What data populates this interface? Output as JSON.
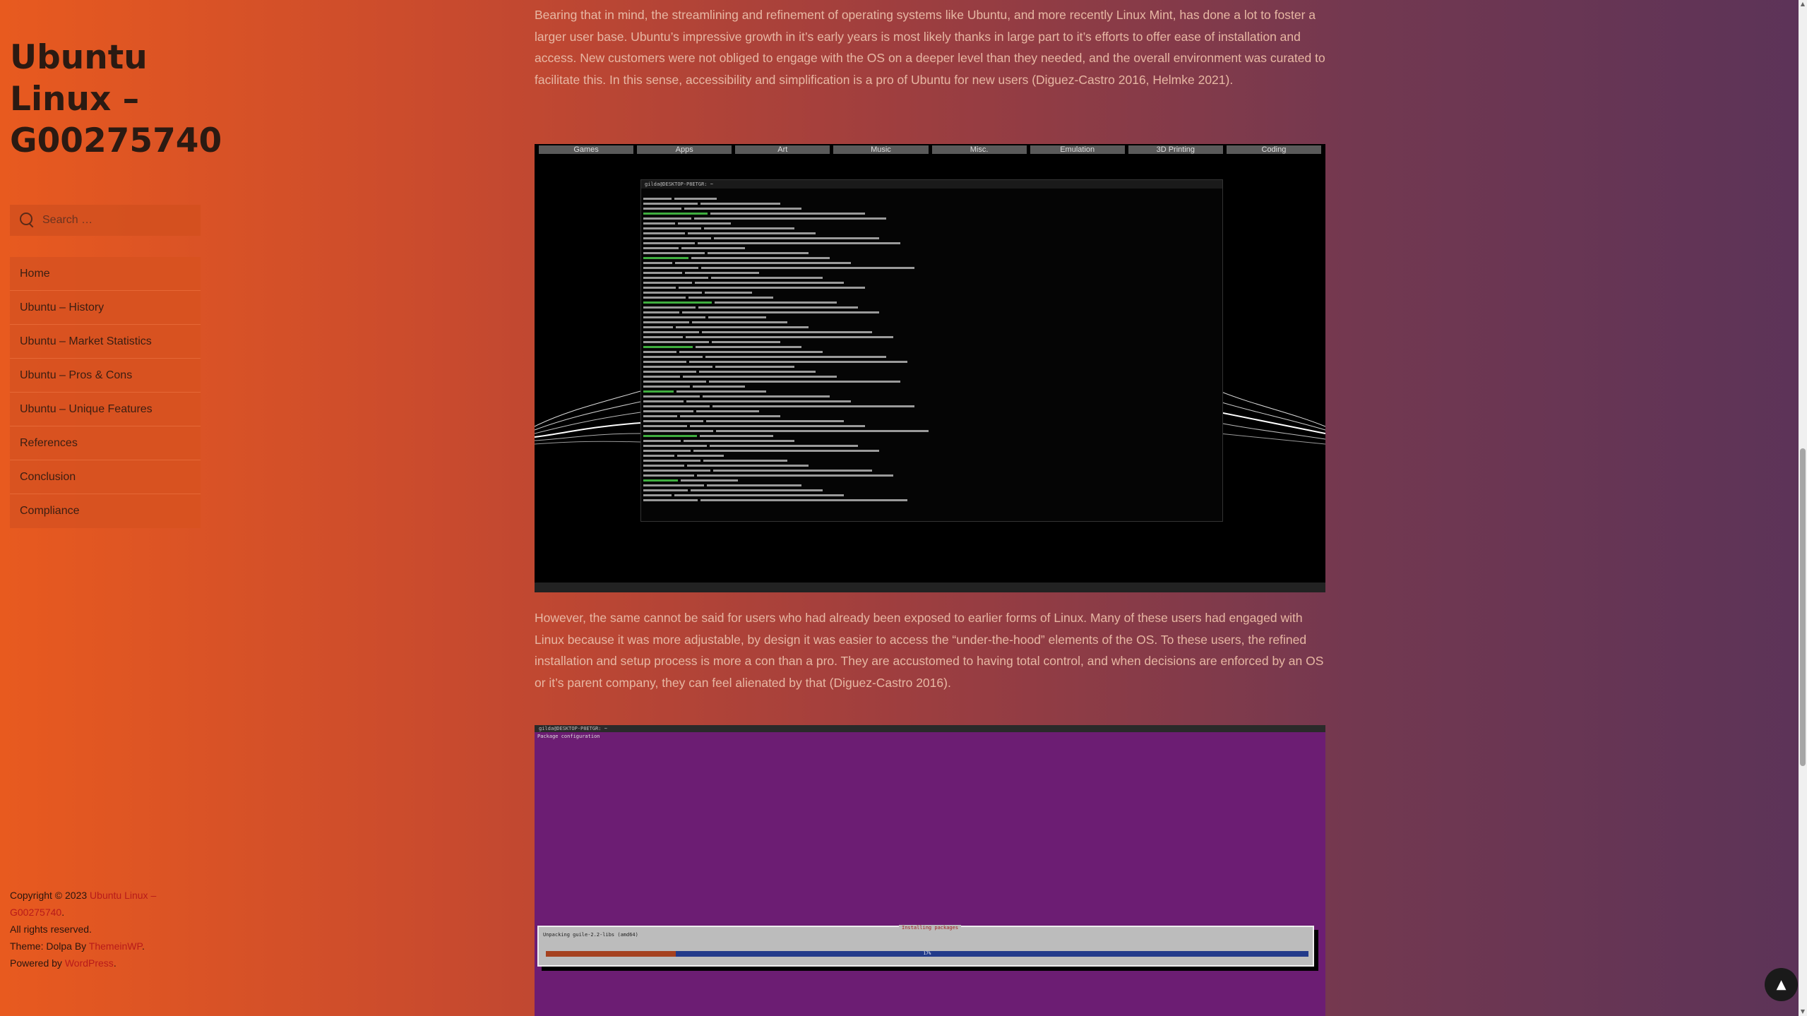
{
  "site": {
    "title": "Ubuntu Linux – G00275740"
  },
  "search": {
    "placeholder": "Search …"
  },
  "nav": {
    "items": [
      {
        "label": "Home"
      },
      {
        "label": "Ubuntu – History"
      },
      {
        "label": "Ubuntu – Market Statistics"
      },
      {
        "label": "Ubuntu – Pros & Cons"
      },
      {
        "label": "Ubuntu – Unique Features"
      },
      {
        "label": "References"
      },
      {
        "label": "Conclusion"
      },
      {
        "label": "Compliance"
      }
    ]
  },
  "footer": {
    "copyright_prefix": "Copyright © 2023 ",
    "site_link": "Ubuntu Linux – G00275740",
    "period": ".",
    "rights": "All rights reserved.",
    "theme_prefix": "Theme: Dolpa By ",
    "theme_link": "ThemeinWP",
    "powered_prefix": "Powered by ",
    "powered_link": "WordPress"
  },
  "content": {
    "paragraph1": "Bearing that in mind, the streamlining and refinement of operating systems like Ubuntu, and more recently Linux Mint, has done a lot to foster a larger user base. Ubuntu’s impressive growth in it’s early years is most likely thanks in large part to it’s efforts to offer ease of installation and access. New customers were not obliged to engage with the OS on a deeper level than they needed, and the overall environment was curated to facilitate this. In this sense, accessibility and simplification is a pro of Ubuntu for new users (Diguez-Castro 2016, Helmke 2021).",
    "paragraph2": "However, the same cannot be said for users who had already been exposed to earlier forms of Linux. Many of these users had engaged with Linux because it was more adjustable, by design it was easier to access the “under-the-hood” elements of the OS. To these users, the refined installation and setup process is more a con than a pro. They are accustomed to having total control, and when decisions are enforced by an OS or it’s parent company, they can feel alienated by that (Diguez-Castro 2016)."
  },
  "screenshot1": {
    "categories": [
      "Games",
      "Apps",
      "Art",
      "Music",
      "Misc.",
      "Emulation",
      "3D Printing",
      "Coding"
    ],
    "terminal_title": "gilda@DESKTOP-P8ETGR: ~"
  },
  "screenshot2": {
    "window_title": "gilda@DESKTOP-P8ETGR: ~",
    "label": "Package configuration",
    "box_title": "Installing packages",
    "box_text": "Unpacking guile-2.2-libs (amd64)",
    "progress": 17,
    "progress_label": "17%"
  },
  "colors": {
    "accent": "#b81a1a",
    "bg_start": "#e85a1f",
    "bg_end": "#5c3358",
    "nav_bg": "#d75220",
    "terminal_bg": "#050505",
    "installer_bg": "#6c1d73"
  }
}
